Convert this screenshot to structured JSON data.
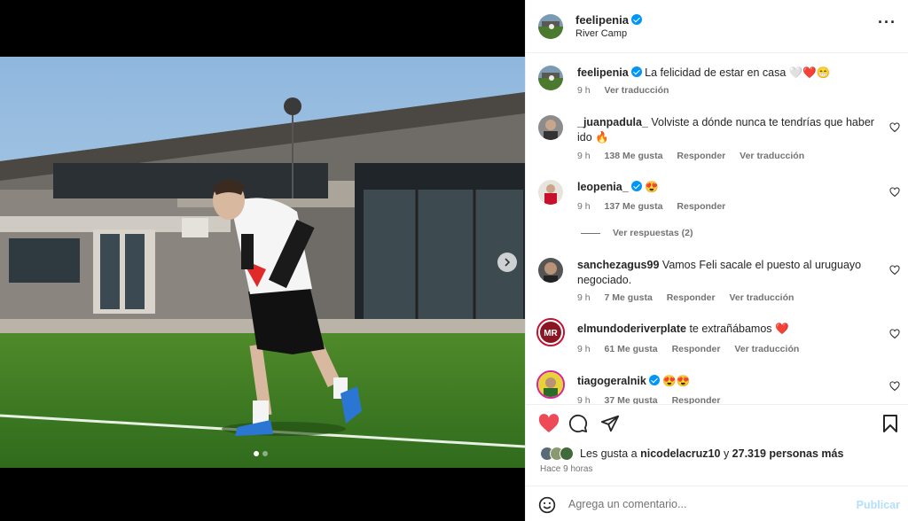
{
  "header": {
    "username": "feelipenia",
    "location": "River Camp",
    "more_icon": "more-horizontal-icon"
  },
  "comments": [
    {
      "username": "feelipenia",
      "verified": true,
      "text": "La felicidad de estar en casa 🤍❤️😁",
      "time": "9 h",
      "translate": "Ver traducción"
    },
    {
      "username": "_juanpadula_",
      "text": "Volviste a dónde nunca te tendrías que haber ido 🔥",
      "time": "9 h",
      "likes": "138 Me gusta",
      "reply": "Responder",
      "translate": "Ver traducción"
    },
    {
      "username": "leopenia_",
      "verified": true,
      "text": "😍",
      "time": "9 h",
      "likes": "137 Me gusta",
      "reply": "Responder",
      "replies": "Ver respuestas (2)"
    },
    {
      "username": "sanchezagus99",
      "text": "Vamos Feli sacale el puesto al uruguayo negociado.",
      "time": "9 h",
      "likes": "7 Me gusta",
      "reply": "Responder",
      "translate": "Ver traducción"
    },
    {
      "username": "elmundoderiverplate",
      "avatar_text": "MR",
      "text": "te extrañábamos ❤️",
      "time": "9 h",
      "likes": "61 Me gusta",
      "reply": "Responder",
      "translate": "Ver traducción"
    },
    {
      "username": "tiagogeralnik",
      "verified": true,
      "text": "😍😍",
      "time": "9 h",
      "likes": "37 Me gusta",
      "reply": "Responder"
    }
  ],
  "likes": {
    "prefix": "Les gusta a",
    "user": "nicodelacruz10",
    "joiner": "y",
    "count": "27.319 personas más"
  },
  "post_time": "Hace 9 horas",
  "add_comment": {
    "placeholder": "Agrega un comentario...",
    "publish": "Publicar"
  },
  "carousel": {
    "slides": 2,
    "current": 1
  },
  "colors": {
    "like": "#ed4956",
    "verified": "#0095f6",
    "publish_disabled": "#b2dffc"
  }
}
